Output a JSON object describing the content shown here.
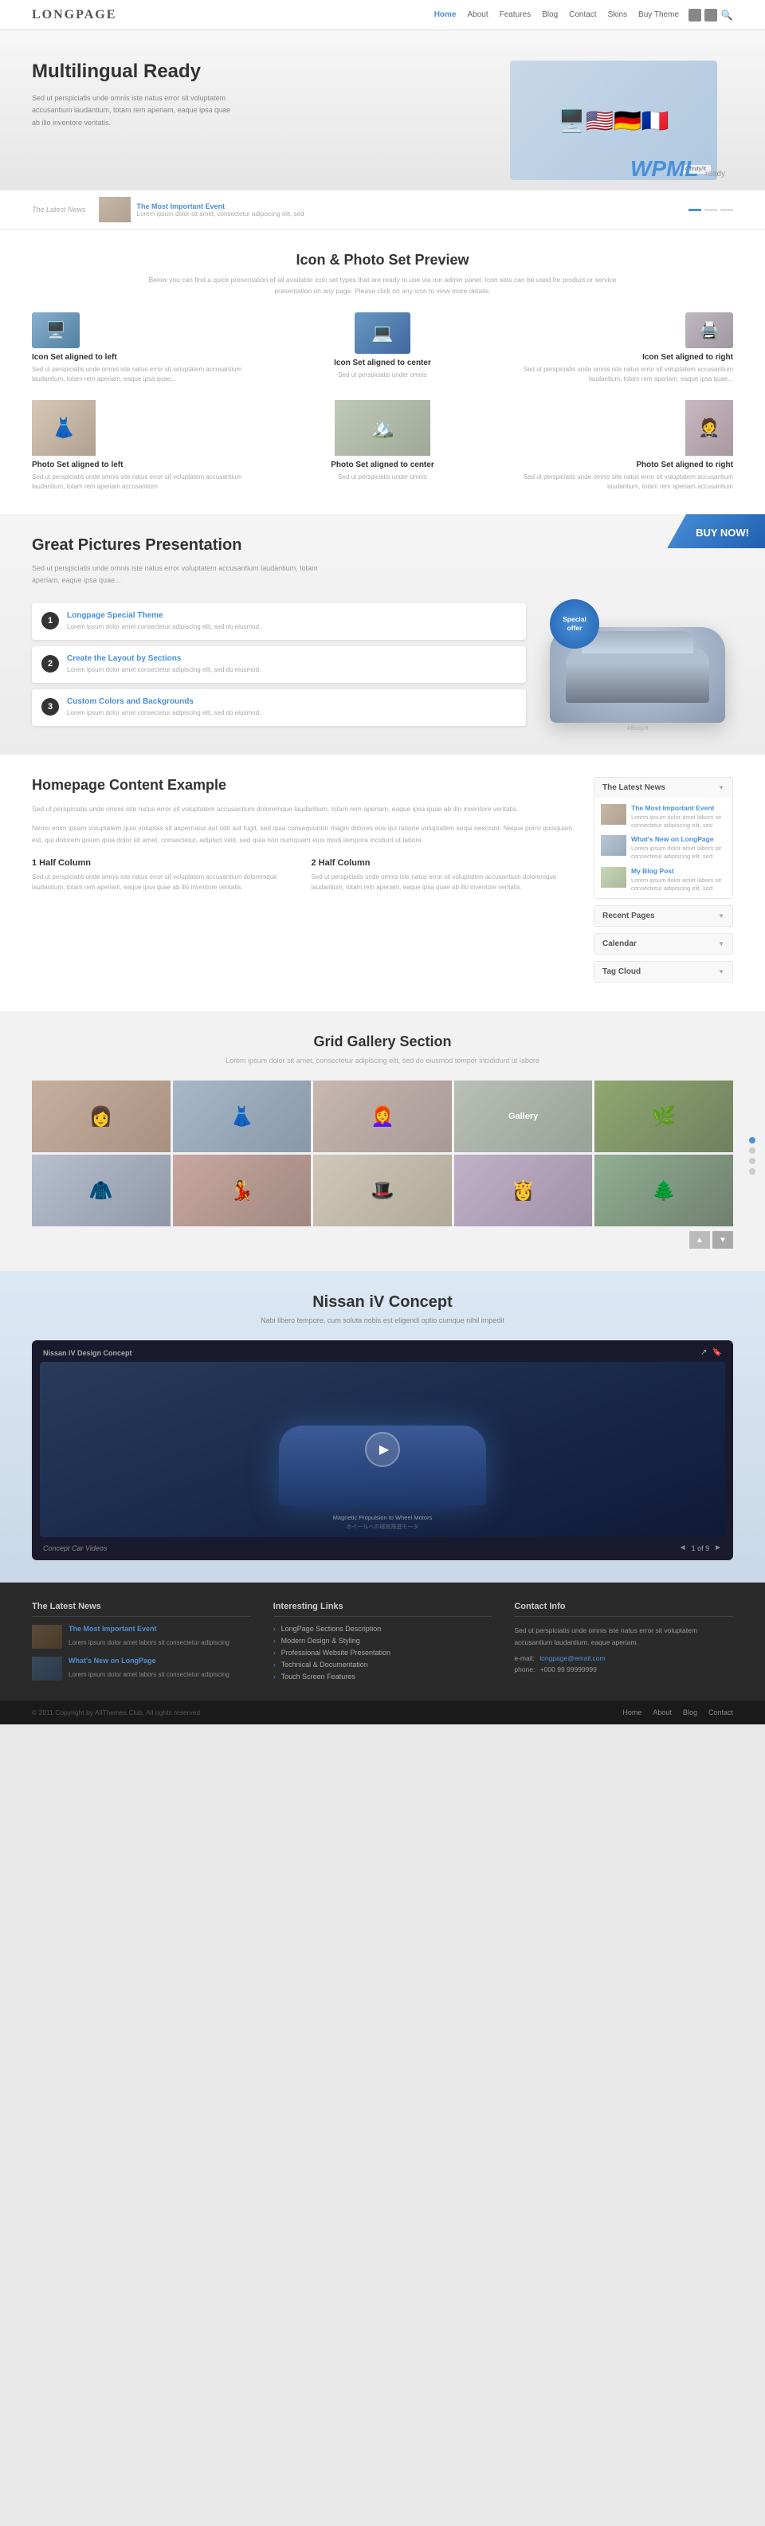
{
  "nav": {
    "logo": "LONGPAGE",
    "links": [
      "Home",
      "About",
      "Features",
      "Blog",
      "Contact",
      "Skins",
      "Buy Theme"
    ],
    "active": "Home"
  },
  "hero": {
    "title": "Multilingual Ready",
    "description": "Sed ut perspiciatis unde omnis iste natus error sit voluptatem accusantium laudantium, totam rem aperiam, eaque ipsa quae ab illo inventore veritatis.",
    "news_label": "The Latest News",
    "news_link": "The Most Important Event",
    "news_text": "Lorem ipsum dolor sit amet, consectetur adipiscing elit, sed",
    "wpml": "WPML",
    "wpml_ready": "ready"
  },
  "icon_section": {
    "title": "Icon & Photo Set Preview",
    "subtitle": "Below you can find a quick presentation of all available icon set types that are ready to use via our admin panel. Icon sets can be used for product or service presentation on any page. Please click on any icon to view more details.",
    "items": [
      {
        "title": "Icon Set aligned to left",
        "text": "Sed ut perspiciatis unde omnis iste natus error sit voluptatem accusantium laudantium, totam rem aperiam, eaque ipsa quae..."
      },
      {
        "title": "Icon Set aligned to center",
        "text": "Sed ut perspiciatis under omnis"
      },
      {
        "title": "Icon Set aligned to right",
        "text": "Sed ut perspiciatis unde omnis iste natus error sit voluptatem accusantium laudantium, totam rem aperiam, eaque ipsa quae..."
      }
    ],
    "photo_items": [
      {
        "title": "Photo Set aligned to left",
        "text": "Sed ut perspiciatis unde omnis site natus error sit voluptatem accusantium laudantium, totam rem aperiam accusantium"
      },
      {
        "title": "Photo Set aligned to center",
        "text": "Sed ut perspiciatis under omnis"
      },
      {
        "title": "Photo Set aligned to right",
        "text": "Sed ut perspiciatis unde omnis site natus error sit voluptatem accusantium laudantium, totam rem aperiam accusantium"
      }
    ]
  },
  "great_section": {
    "title": "Great Pictures Presentation",
    "description": "Sed ut perspiciatis unde omnis iste natus error voluptatem accusantium laudantium, totam aperiam, eaque ipsa quae...",
    "buy_now": "BUY NOW!",
    "items": [
      {
        "num": "1",
        "title": "Longpage Special Theme",
        "text": "Lorem ipsum dolor amet consectetur adipiscing elit, sed do eiusmod."
      },
      {
        "num": "2",
        "title": "Create the Layout by Sections",
        "text": "Lorem ipsum dolor amet consectetur adipiscing elit, sed do eiusmod."
      },
      {
        "num": "3",
        "title": "Custom Colors and Backgrounds",
        "text": "Lorem ipsum dolor amet consectetur adipiscing elit, sed do eiusmod."
      }
    ],
    "special_offer": "Special offer"
  },
  "homepage": {
    "title": "Homepage Content Example",
    "text1": "Sed ut perspiciatis unde omnis iste natus error sit voluptatem accusantium doloremque laudantium, totam rem aperiam, eaque ipsa quae ab illo inventore veritatis.",
    "text2": "Nemo enim ipsam voluptatem quia voluptas sit aspernatur aut odit aut fugit, sed quia consequuntur magni dolores eos qui ratione voluptatem sequi nesciunt. Neque porro quisquam est, qui dolorem ipsum quia dolor sit amet, consectetur, adipisci velit, sed quia non numquam eius modi tempora incidunt ut labore.",
    "col1_title": "1 Half Column",
    "col1_text": "Sed ut perspiciatis unde omnis iste natus error sit voluptatem accusantium doloremque laudantium, totam rem aperiam, eaque ipsa quae ab illo inventore veritatis.",
    "col2_title": "2 Half Column",
    "col2_text": "Sed ut perspiciatis unde omnis iste natus error sit voluptatem accusantium doloremque laudantium, totam rem aperiam, eaque ipsa quae ab illo inventore veritatis.",
    "sidebar": {
      "latest_news": "The Latest News",
      "news_items": [
        {
          "title": "The Most Important Event",
          "text": "Lorem ipsum dolor amet labors sit consectetur adipiscing elit, sed"
        },
        {
          "title": "What's New on LongPage",
          "text": "Lorem ipsum dolor amet labors sit consectetur adipiscing elit, sed"
        },
        {
          "title": "My Blog Post",
          "text": "Lorem ipsum dolor amet labors sit consectetur adipiscing elit, sed"
        }
      ],
      "recent_pages": "Recent Pages",
      "calendar": "Calendar",
      "tag_cloud": "Tag Cloud"
    }
  },
  "gallery": {
    "title": "Grid Gallery Section",
    "subtitle": "Lorem ipsum dolor sit amet, consectetur adipiscing elit, sed do eiusmod tempor incididunt ut labore"
  },
  "nissan": {
    "title": "Nissan iV Concept",
    "subtitle": "Nabi libero tempore, cum soluta nobis est eligendi optio cumque nihil impedit",
    "video_label": "Nissan iV Design Concept",
    "video_text": "Magnetic Propulsion to Wheel Motors\nホイールへの磁気推進モータ",
    "footer_label": "Concept Car Videos",
    "counter": "1 of 9"
  },
  "footer": {
    "latest_news_title": "The Latest News",
    "links_title": "Interesting Links",
    "contact_title": "Contact Info",
    "news_items": [
      {
        "title": "The Most Important Event",
        "text": "Lorem ipsum dolor amet labors sit consectetur adipiscing"
      },
      {
        "title": "What's New on LongPage",
        "text": "Lorem ipsum dolor amet labors sit consectetur adipiscing"
      }
    ],
    "links": [
      "LongPage Sections Description",
      "Modern Design & Styling",
      "Professional Website Presentation",
      "Technical & Documentation",
      "Touch Screen Features"
    ],
    "contact_text": "Sed ut perspiciatis unde omnis iste natus error sit voluptatem accusantium laudantium, eaque aperiam.",
    "email_label": "e-mail:",
    "email": "longpage@email.com",
    "phone_label": "phone:",
    "phone": "+000 99 99999999",
    "copyright": "© 2011 Copyright by AllThemes.Club, All rights reserved",
    "bottom_links": [
      "Home",
      "About",
      "Blog",
      "Contact"
    ]
  }
}
